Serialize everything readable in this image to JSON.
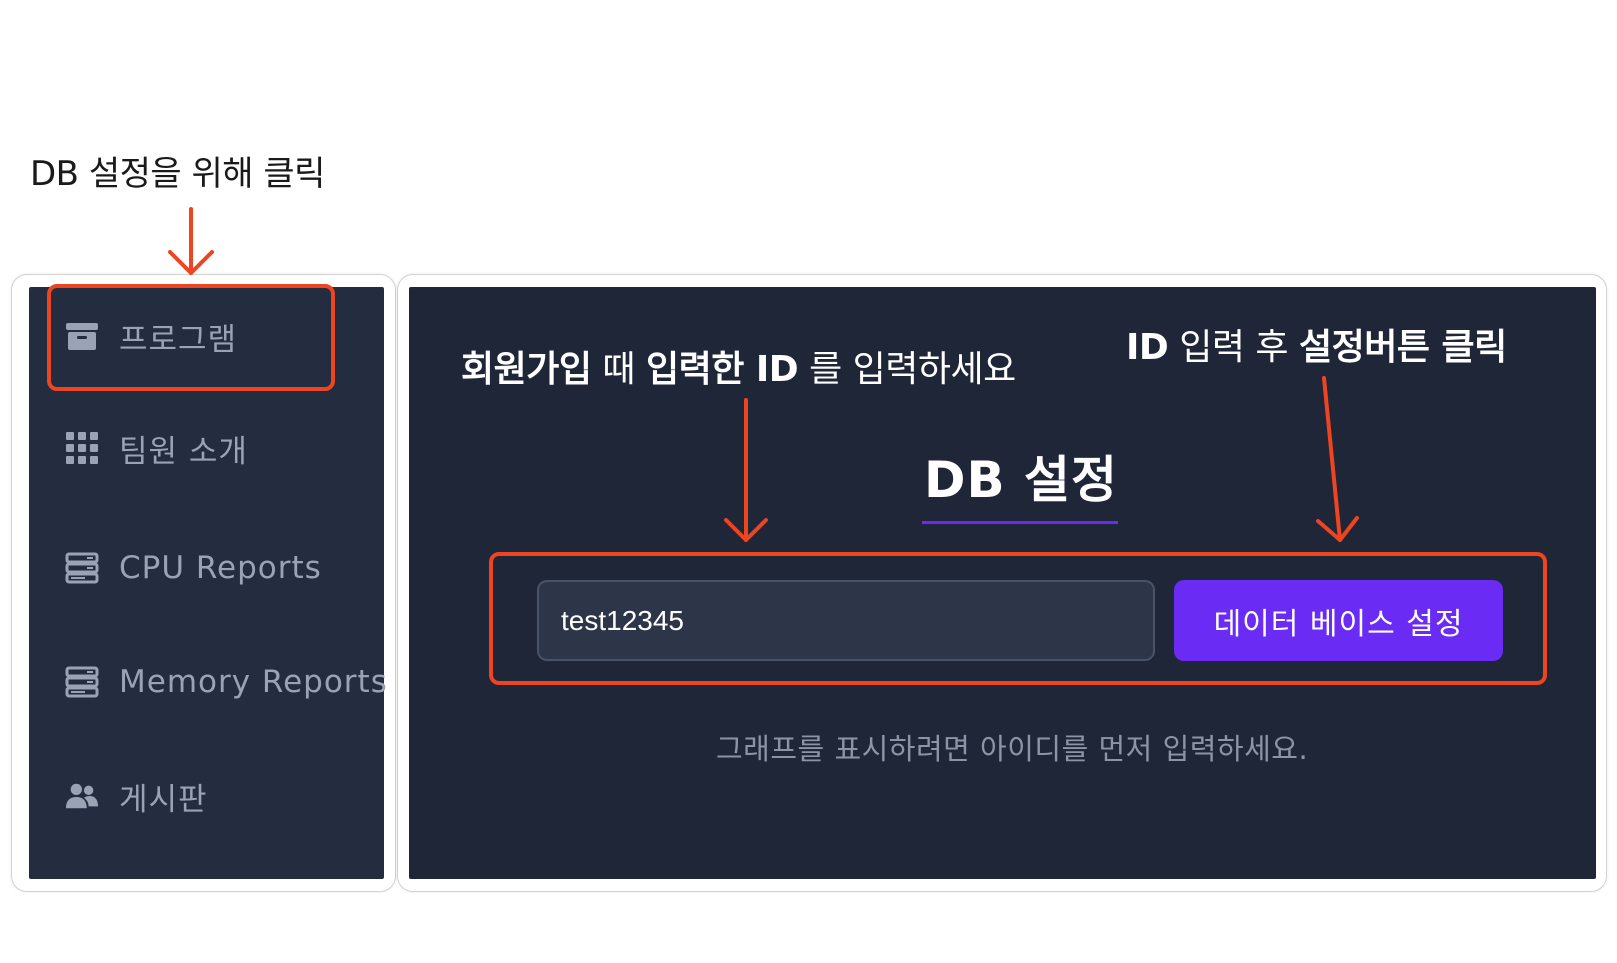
{
  "top_caption": "DB 설정을 위해 클릭",
  "sidebar": {
    "items": [
      {
        "label": "프로그램",
        "icon": "archive-box-icon"
      },
      {
        "label": "팀원 소개",
        "icon": "grid-icon"
      },
      {
        "label": "CPU Reports",
        "icon": "server-icon"
      },
      {
        "label": "Memory Reports",
        "icon": "server-icon"
      },
      {
        "label": "게시판",
        "icon": "users-icon"
      }
    ]
  },
  "main": {
    "title": "DB 설정",
    "input_value": "test12345",
    "button_label": "데이터 베이스 설정",
    "hint": "그래프를 표시하려면 아이디를 먼저 입력하세요."
  },
  "annotations": {
    "enter_id": {
      "bold1": "회원가입",
      "text1": " 때 ",
      "bold2": "입력한 ID",
      "text2": " 를 입력하세요"
    },
    "click_button": {
      "bold1": "ID",
      "text1": " 입력 후 ",
      "bold2": "설정버튼 클릭"
    }
  },
  "colors": {
    "accent": "#6a2cf5",
    "highlight": "#ef4420",
    "sidebar_bg": "#232d3f",
    "panel_bg": "#1f2638"
  }
}
